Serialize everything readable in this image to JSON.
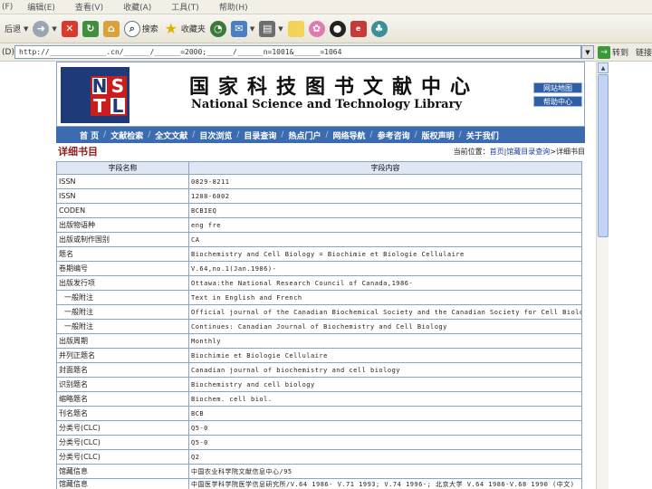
{
  "menubar": {
    "items": [
      "(F)",
      "编辑(E)",
      "查看(V)",
      "收藏(A)",
      "工具(T)",
      "帮助(H)"
    ]
  },
  "toolbar": {
    "back_label": "后退",
    "search_label": "搜索",
    "favorites_label": "收藏夹"
  },
  "address": {
    "label": "(D)",
    "url": "http://_____________.cn/______/______=2000;______/______n=1001&______=1064",
    "go_label": "转到",
    "links_label": "链接"
  },
  "banner": {
    "logo_letters": [
      "N",
      "S",
      "T",
      "L"
    ],
    "title_cn": "国家科技图书文献中心",
    "title_en": "National Science and Technology Library",
    "side_links": [
      "网站地图",
      "帮助中心"
    ]
  },
  "nav": {
    "items": [
      "首 页",
      "文献检索",
      "全文文献",
      "目次浏览",
      "目录查询",
      "热点门户",
      "网络导航",
      "参考咨询",
      "版权声明",
      "关于我们"
    ]
  },
  "page": {
    "title": "详细书目",
    "breadcrumb_prefix": "当前位置：",
    "breadcrumb_home": "首页",
    "breadcrumb_mid": "馆藏目录查询",
    "breadcrumb_current": ">详细书目"
  },
  "table": {
    "headers": [
      "字段名称",
      "字段内容"
    ],
    "rows": [
      {
        "field": "ISSN",
        "value": "0829-8211",
        "indent": false
      },
      {
        "field": "ISSN",
        "value": "1208-6002",
        "indent": false
      },
      {
        "field": "CODEN",
        "value": "BCBIEQ",
        "indent": false
      },
      {
        "field": "出版物语种",
        "value": "eng fre",
        "indent": false
      },
      {
        "field": "出版或制作国别",
        "value": "CA",
        "indent": false
      },
      {
        "field": "题名",
        "value": "Biochemistry and Cell Biology = Biochimie et Biologie Cellulaire",
        "indent": false
      },
      {
        "field": "卷期编号",
        "value": "V.64,no.1(Jan.1986)-",
        "indent": false
      },
      {
        "field": "出版发行项",
        "value": "Ottawa:the National Research Council of Canada,1986-",
        "indent": false
      },
      {
        "field": "一般附注",
        "value": "Text in English and French",
        "indent": true
      },
      {
        "field": "一般附注",
        "value": "Official journal of the Canadian Biochemical Society and the Canadian Society for Cell Biology",
        "indent": true
      },
      {
        "field": "一般附注",
        "value": "Continues: Canadian Journal of Biochemistry and Cell Biology",
        "indent": true
      },
      {
        "field": "出版周期",
        "value": "Monthly",
        "indent": false
      },
      {
        "field": "并列正题名",
        "value": "Biochimie et Biologie Cellulaire",
        "indent": false
      },
      {
        "field": "封面题名",
        "value": "Canadian journal of biochemistry and cell biology",
        "indent": false
      },
      {
        "field": "识别题名",
        "value": "Biochemistry and cell biology",
        "indent": false
      },
      {
        "field": "缩略题名",
        "value": "Biochem. cell biol.",
        "indent": false
      },
      {
        "field": "刊名题名",
        "value": "BCB",
        "indent": false
      },
      {
        "field": "分类号(CLC)",
        "value": "Q5-0",
        "indent": false
      },
      {
        "field": "分类号(CLC)",
        "value": "Q5-0",
        "indent": false
      },
      {
        "field": "分类号(CLC)",
        "value": "Q2",
        "indent": false
      },
      {
        "field": "馆藏信息",
        "value": "中国农业科学院文献信息中心/95",
        "indent": false
      },
      {
        "field": "馆藏信息",
        "value": "中国医学科学院医学信息研究所/V.64 1986- V.71 1993; V.74 1996-; 北京大学 V.64 1986-V.68 1990 (中文)",
        "indent": false,
        "tall": true
      }
    ]
  }
}
